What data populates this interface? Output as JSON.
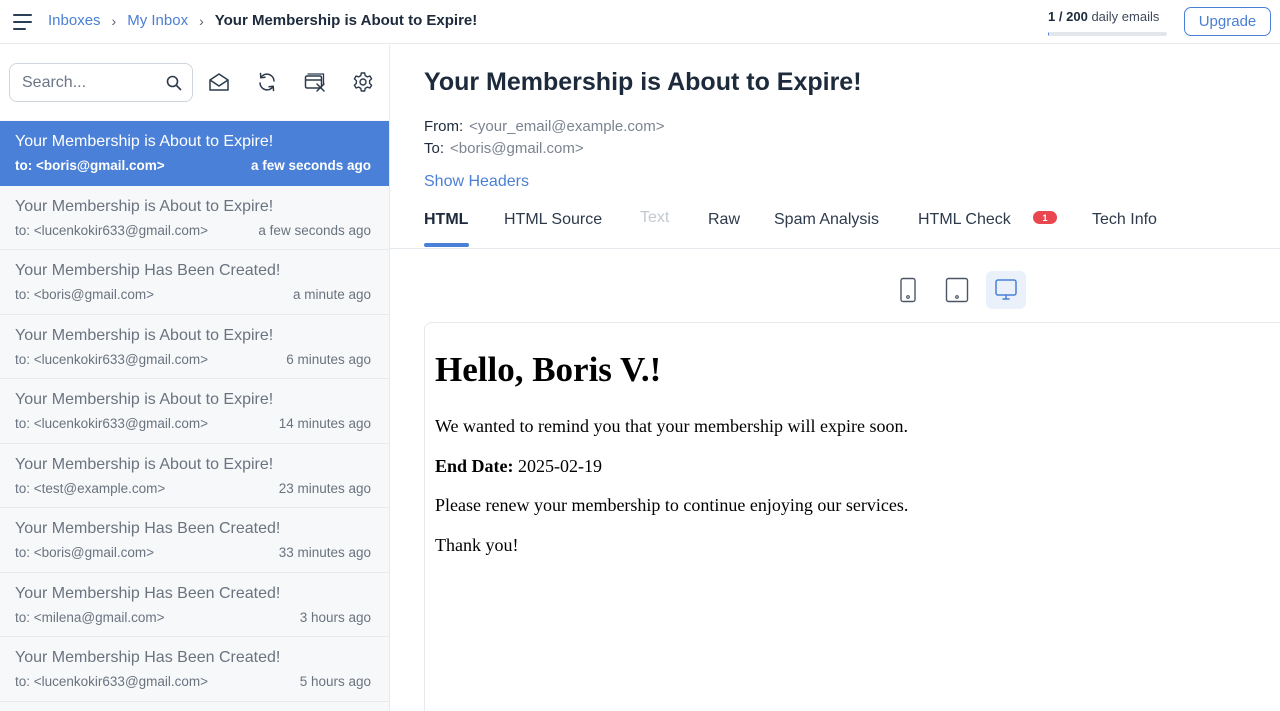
{
  "breadcrumb": {
    "items": [
      "Inboxes",
      "My Inbox"
    ],
    "separator": "›",
    "current": "Your Membership is About to Expire!"
  },
  "quota": {
    "used": "1",
    "slash": "/",
    "limit": "200",
    "label": "daily emails",
    "fraction": 0.005
  },
  "upgrade_label": "Upgrade",
  "search": {
    "placeholder": "Search..."
  },
  "toolbar_icons": [
    "search-icon",
    "mail-open-icon",
    "refresh-icon",
    "clear-inbox-icon",
    "gear-icon"
  ],
  "emails": [
    {
      "subject": "Your Membership is About to Expire!",
      "to": "to: <boris@gmail.com>",
      "time": "a few seconds ago"
    },
    {
      "subject": "Your Membership is About to Expire!",
      "to": "to: <lucenkokir633@gmail.com>",
      "time": "a few seconds ago"
    },
    {
      "subject": "Your Membership Has Been Created!",
      "to": "to: <boris@gmail.com>",
      "time": "a minute ago"
    },
    {
      "subject": "Your Membership is About to Expire!",
      "to": "to: <lucenkokir633@gmail.com>",
      "time": "6 minutes ago"
    },
    {
      "subject": "Your Membership is About to Expire!",
      "to": "to: <lucenkokir633@gmail.com>",
      "time": "14 minutes ago"
    },
    {
      "subject": "Your Membership is About to Expire!",
      "to": "to: <test@example.com>",
      "time": "23 minutes ago"
    },
    {
      "subject": "Your Membership Has Been Created!",
      "to": "to: <boris@gmail.com>",
      "time": "33 minutes ago"
    },
    {
      "subject": "Your Membership Has Been Created!",
      "to": "to: <milena@gmail.com>",
      "time": "3 hours ago"
    },
    {
      "subject": "Your Membership Has Been Created!",
      "to": "to: <lucenkokir633@gmail.com>",
      "time": "5 hours ago"
    }
  ],
  "message": {
    "title": "Your Membership is About to Expire!",
    "from_label": "From:",
    "from": "<your_email@example.com>",
    "to_label": "To:",
    "to": "<boris@gmail.com>",
    "show_headers": "Show Headers"
  },
  "tabs": [
    {
      "label": "HTML",
      "state": "active"
    },
    {
      "label": "HTML Source",
      "state": "normal"
    },
    {
      "label": "Text",
      "state": "disabled"
    },
    {
      "label": "Raw",
      "state": "normal"
    },
    {
      "label": "Spam Analysis",
      "state": "normal"
    },
    {
      "label": "HTML Check",
      "state": "normal",
      "badge": "1"
    },
    {
      "label": "Tech Info",
      "state": "normal"
    }
  ],
  "device_views": [
    {
      "icon": "mobile-icon",
      "active": false
    },
    {
      "icon": "tablet-icon",
      "active": false
    },
    {
      "icon": "desktop-icon",
      "active": true
    }
  ],
  "email_body": {
    "greeting": "Hello, Boris V.!",
    "line1": "We wanted to remind you that your membership will expire soon.",
    "end_date_label": "End Date:",
    "end_date": "2025-02-19",
    "line2": "Please renew your membership to continue enjoying our services.",
    "line3": "Thank you!"
  },
  "colors": {
    "accent": "#4a80d8",
    "badge": "#e8474f",
    "text_dark": "#1c2a3c",
    "text_muted": "#6a7380"
  }
}
